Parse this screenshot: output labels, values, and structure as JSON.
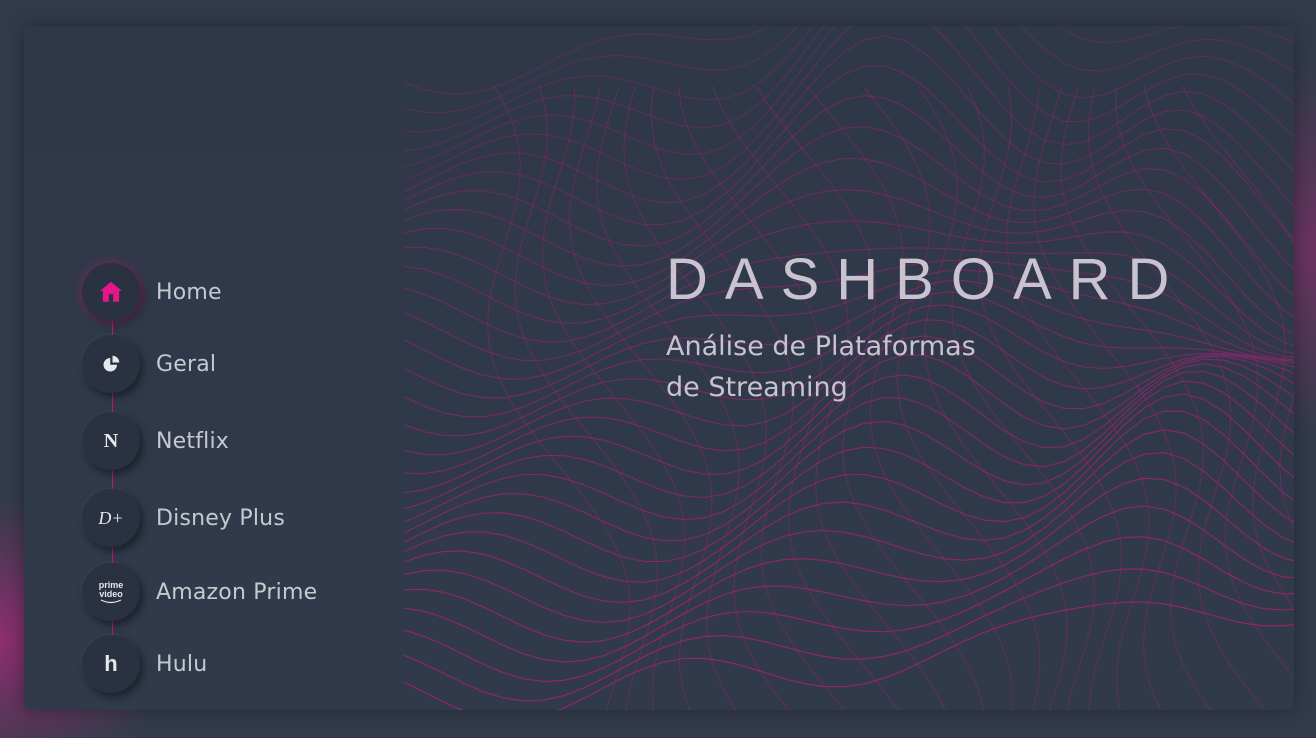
{
  "header": {
    "title": "DASHBOARD",
    "subtitle_line1": "Análise de Plataformas",
    "subtitle_line2": "de Streaming"
  },
  "nav": {
    "items": [
      {
        "label": "Home",
        "icon": "home-icon",
        "active": true
      },
      {
        "label": "Geral",
        "icon": "pie-chart-icon",
        "active": false
      },
      {
        "label": "Netflix",
        "icon": "netflix-logo-icon",
        "active": false
      },
      {
        "label": "Disney Plus",
        "icon": "disney-plus-logo-icon",
        "active": false
      },
      {
        "label": "Amazon Prime",
        "icon": "prime-video-logo-icon",
        "active": false
      },
      {
        "label": "Hulu",
        "icon": "hulu-logo-icon",
        "active": false
      }
    ],
    "icon_text": {
      "netflix": "N",
      "disney": "D+",
      "prime_line1": "prime",
      "prime_line2": "video",
      "hulu": "h"
    }
  },
  "colors": {
    "accent": "#e5168a",
    "background": "#323a4a",
    "panel": "#2f3849",
    "text": "#c7c9d0"
  }
}
